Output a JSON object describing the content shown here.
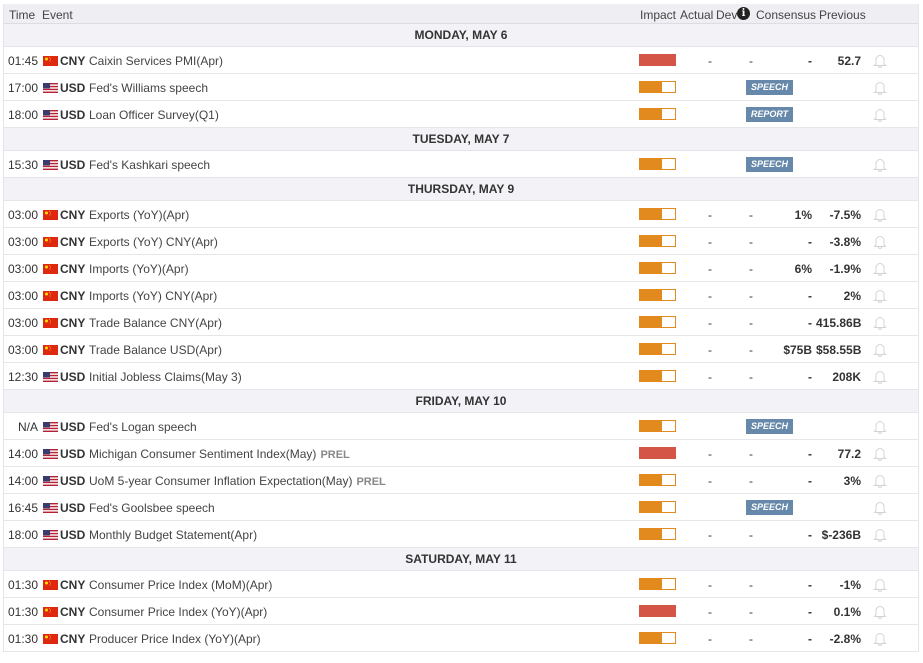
{
  "header": {
    "time": "Time",
    "event": "Event",
    "impact": "Impact",
    "actual": "Actual",
    "dev": "Dev",
    "consensus": "Consensus",
    "previous": "Previous"
  },
  "days": [
    {
      "label": "MONDAY, MAY 6",
      "events": [
        {
          "time": "01:45",
          "cur": "CNY",
          "name": "Caixin Services PMI(Apr)",
          "impact": "high",
          "actual": "-",
          "dev": "-",
          "consensus": "-",
          "previous": "52.7"
        },
        {
          "time": "17:00",
          "cur": "USD",
          "name": "Fed's Williams speech",
          "impact": "medium",
          "badge": "SPEECH"
        },
        {
          "time": "18:00",
          "cur": "USD",
          "name": "Loan Officer Survey(Q1)",
          "impact": "medium",
          "badge": "REPORT"
        }
      ]
    },
    {
      "label": "TUESDAY, MAY 7",
      "events": [
        {
          "time": "15:30",
          "cur": "USD",
          "name": "Fed's Kashkari speech",
          "impact": "medium",
          "badge": "SPEECH"
        }
      ]
    },
    {
      "label": "THURSDAY, MAY 9",
      "events": [
        {
          "time": "03:00",
          "cur": "CNY",
          "name": "Exports (YoY)(Apr)",
          "impact": "medium",
          "actual": "-",
          "dev": "-",
          "consensus": "1%",
          "previous": "-7.5%"
        },
        {
          "time": "03:00",
          "cur": "CNY",
          "name": "Exports (YoY) CNY(Apr)",
          "impact": "medium",
          "actual": "-",
          "dev": "-",
          "consensus": "-",
          "previous": "-3.8%"
        },
        {
          "time": "03:00",
          "cur": "CNY",
          "name": "Imports (YoY)(Apr)",
          "impact": "medium",
          "actual": "-",
          "dev": "-",
          "consensus": "6%",
          "previous": "-1.9%"
        },
        {
          "time": "03:00",
          "cur": "CNY",
          "name": "Imports (YoY) CNY(Apr)",
          "impact": "medium",
          "actual": "-",
          "dev": "-",
          "consensus": "-",
          "previous": "2%"
        },
        {
          "time": "03:00",
          "cur": "CNY",
          "name": "Trade Balance CNY(Apr)",
          "impact": "medium",
          "actual": "-",
          "dev": "-",
          "consensus": "-",
          "previous": "415.86B"
        },
        {
          "time": "03:00",
          "cur": "CNY",
          "name": "Trade Balance USD(Apr)",
          "impact": "medium",
          "actual": "-",
          "dev": "-",
          "consensus": "$75B",
          "previous": "$58.55B"
        },
        {
          "time": "12:30",
          "cur": "USD",
          "name": "Initial Jobless Claims(May 3)",
          "impact": "medium",
          "actual": "-",
          "dev": "-",
          "consensus": "-",
          "previous": "208K"
        }
      ]
    },
    {
      "label": "FRIDAY, MAY 10",
      "events": [
        {
          "time": "N/A",
          "cur": "USD",
          "name": "Fed's Logan speech",
          "impact": "medium",
          "badge": "SPEECH"
        },
        {
          "time": "14:00",
          "cur": "USD",
          "name": "Michigan Consumer Sentiment Index(May)",
          "tag": "PREL",
          "impact": "high",
          "actual": "-",
          "dev": "-",
          "consensus": "-",
          "previous": "77.2"
        },
        {
          "time": "14:00",
          "cur": "USD",
          "name": "UoM 5-year Consumer Inflation Expectation(May)",
          "tag": "PREL",
          "impact": "medium",
          "actual": "-",
          "dev": "-",
          "consensus": "-",
          "previous": "3%"
        },
        {
          "time": "16:45",
          "cur": "USD",
          "name": "Fed's Goolsbee speech",
          "impact": "medium",
          "badge": "SPEECH"
        },
        {
          "time": "18:00",
          "cur": "USD",
          "name": "Monthly Budget Statement(Apr)",
          "impact": "medium",
          "actual": "-",
          "dev": "-",
          "consensus": "-",
          "previous": "$-236B"
        }
      ]
    },
    {
      "label": "SATURDAY, MAY 11",
      "events": [
        {
          "time": "01:30",
          "cur": "CNY",
          "name": "Consumer Price Index (MoM)(Apr)",
          "impact": "medium",
          "actual": "-",
          "dev": "-",
          "consensus": "-",
          "previous": "-1%"
        },
        {
          "time": "01:30",
          "cur": "CNY",
          "name": "Consumer Price Index (YoY)(Apr)",
          "impact": "high",
          "actual": "-",
          "dev": "-",
          "consensus": "-",
          "previous": "0.1%"
        },
        {
          "time": "01:30",
          "cur": "CNY",
          "name": "Producer Price Index (YoY)(Apr)",
          "impact": "medium",
          "actual": "-",
          "dev": "-",
          "consensus": "-",
          "previous": "-2.8%"
        }
      ]
    }
  ]
}
